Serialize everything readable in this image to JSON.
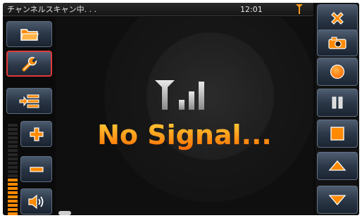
{
  "status_bar": {
    "title": "チャンネルスキャン中. . .",
    "clock": "12:01",
    "antenna_icon": "antenna-icon"
  },
  "video": {
    "message": "No Signal...",
    "signal_icon": "signal-bars-icon"
  },
  "left_toolbar": {
    "buttons": [
      {
        "name": "folder-button",
        "icon": "folder-icon"
      },
      {
        "name": "settings-button",
        "icon": "wrench-icon",
        "selected": true
      },
      {
        "name": "channel-list-button",
        "icon": "list-add-icon"
      },
      {
        "name": "volume-up-button",
        "icon": "plus-icon"
      },
      {
        "name": "volume-down-button",
        "icon": "minus-icon"
      },
      {
        "name": "mute-button",
        "icon": "speaker-icon"
      }
    ],
    "volume_level": 0.4
  },
  "right_toolbar": {
    "buttons": [
      {
        "name": "close-button",
        "icon": "close-icon"
      },
      {
        "name": "snapshot-button",
        "icon": "camera-icon"
      },
      {
        "name": "record-button",
        "icon": "record-icon"
      },
      {
        "name": "pause-button",
        "icon": "pause-icon"
      },
      {
        "name": "stop-button",
        "icon": "stop-icon"
      },
      {
        "name": "channel-up-button",
        "icon": "triangle-up-icon"
      },
      {
        "name": "channel-down-button",
        "icon": "triangle-down-icon"
      }
    ]
  },
  "colors": {
    "accent_orange": "#ff8a00",
    "selection_red": "#e03a3a",
    "icon_orange": "#ff7a00"
  }
}
